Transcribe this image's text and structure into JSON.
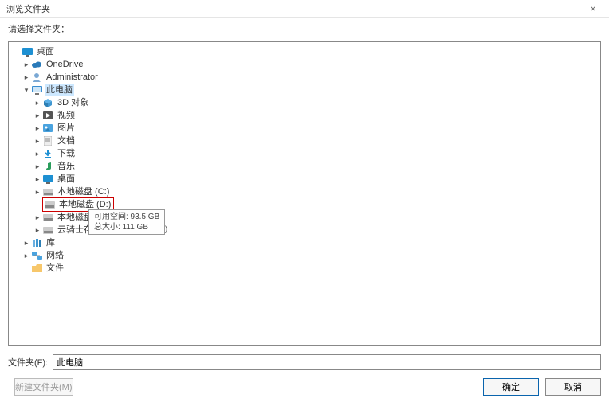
{
  "title": "浏览文件夹",
  "prompt": "请选择文件夹：",
  "folder_label": "文件夹(F):",
  "folder_value": "此电脑",
  "buttons": {
    "new_folder": "新建文件夹(M)",
    "ok": "确定",
    "cancel": "取消"
  },
  "tooltip": {
    "line1": "可用空间: 93.5 GB",
    "line2": "总大小: 111 GB"
  },
  "trail": "9) (Z:)",
  "close": "×",
  "tree": {
    "desktop": "桌面",
    "onedrive": "OneDrive",
    "admin": "Administrator",
    "thispc": "此电脑",
    "obj3d": "3D 对象",
    "videos": "视频",
    "pictures": "图片",
    "documents": "文档",
    "downloads": "下载",
    "music": "音乐",
    "desk2": "桌面",
    "drive_c": "本地磁盘 (C:)",
    "drive_d": "本地磁盘 (D:)",
    "drive_e": "本地磁盘 (",
    "cloud": "云骑士存储",
    "libraries": "库",
    "network": "网络",
    "files": "文件"
  }
}
